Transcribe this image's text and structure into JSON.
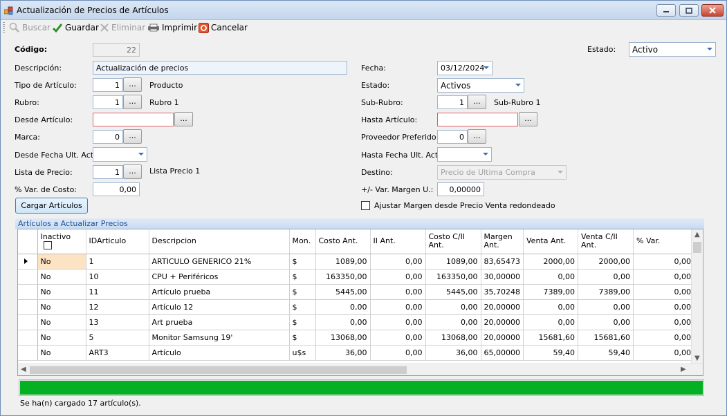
{
  "window": {
    "title": "Actualización de Precios de Artículos",
    "accent_color": "#06b025"
  },
  "toolbar": {
    "buscar": "Buscar",
    "guardar": "Guardar",
    "eliminar": "Eliminar",
    "imprimir": "Imprimir",
    "cancelar": "Cancelar"
  },
  "form": {
    "codigo_label": "Código:",
    "codigo_value": "22",
    "estado_top_label": "Estado:",
    "estado_top_value": "Activo",
    "descripcion_label": "Descripción:",
    "descripcion_value": "Actualización de precios",
    "fecha_label": "Fecha:",
    "fecha_value": "03/12/2024",
    "tipo_label": "Tipo de Artículo:",
    "tipo_value": "1",
    "tipo_desc": "Producto",
    "estado_label": "Estado:",
    "estado_value": "Activos",
    "rubro_label": "Rubro:",
    "rubro_value": "1",
    "rubro_desc": "Rubro 1",
    "subrubro_label": "Sub-Rubro:",
    "subrubro_value": "1",
    "subrubro_desc": "Sub-Rubro 1",
    "desde_art_label": "Desde Artículo:",
    "desde_art_value": "",
    "hasta_art_label": "Hasta Artículo:",
    "hasta_art_value": "",
    "marca_label": "Marca:",
    "marca_value": "0",
    "proveedor_label": "Proveedor Preferido:",
    "proveedor_value": "0",
    "desde_fecha_label": "Desde Fecha Ult. Act.:",
    "desde_fecha_value": "",
    "hasta_fecha_label": "Hasta Fecha Ult. Act.:",
    "hasta_fecha_value": "",
    "lista_label": "Lista de Precio:",
    "lista_value": "1",
    "lista_desc": "Lista Precio 1",
    "destino_label": "Destino:",
    "destino_value": "Precio de Ultima Compra",
    "var_costo_label": "% Var. de Costo:",
    "var_costo_value": "0,00",
    "var_margen_label": "+/- Var. Margen U.:",
    "var_margen_value": "0,00000",
    "cargar_button": "Cargar Artículos",
    "ajustar_label": "Ajustar Margen desde Precio Venta redondeado",
    "ellipsis": "..."
  },
  "grid": {
    "group_title": "Artículos a Actualizar Precios",
    "columns": [
      "Inactivo",
      "IDArticulo",
      "Descripcion",
      "Mon.",
      "Costo Ant.",
      "II Ant.",
      "Costo C/II Ant.",
      "Margen Ant.",
      "Venta Ant.",
      "Venta C/II Ant.",
      "% Var."
    ],
    "rows": [
      [
        "No",
        "1",
        "ARTICULO GENERICO 21%",
        "$",
        "1089,00",
        "0,00",
        "1089,00",
        "83,65473",
        "2000,00",
        "2000,00",
        "0,00"
      ],
      [
        "No",
        "10",
        "CPU + Periféricos",
        "$",
        "163350,00",
        "0,00",
        "163350,00",
        "30,00000",
        "0,00",
        "0,00",
        "0,00"
      ],
      [
        "No",
        "11",
        "Artículo prueba",
        "$",
        "5445,00",
        "0,00",
        "5445,00",
        "35,70248",
        "7389,00",
        "7389,00",
        "0,00"
      ],
      [
        "No",
        "12",
        "Artículo 12",
        "$",
        "0,00",
        "0,00",
        "0,00",
        "20,00000",
        "0,00",
        "0,00",
        "0,00"
      ],
      [
        "No",
        "13",
        "Art prueba",
        "$",
        "0,00",
        "0,00",
        "0,00",
        "20,00000",
        "0,00",
        "0,00",
        "0,00"
      ],
      [
        "No",
        "5",
        "Monitor Samsung 19'",
        "$",
        "13068,00",
        "0,00",
        "13068,00",
        "20,00000",
        "15681,60",
        "15681,60",
        "0,00"
      ],
      [
        "No",
        "ART3",
        "Artículo",
        "u$s",
        "36,00",
        "0,00",
        "36,00",
        "65,00000",
        "59,40",
        "59,40",
        "0,00"
      ]
    ]
  },
  "progress": {
    "value_percent": 100
  },
  "status": "Se ha(n) cargado 17 artículo(s)."
}
